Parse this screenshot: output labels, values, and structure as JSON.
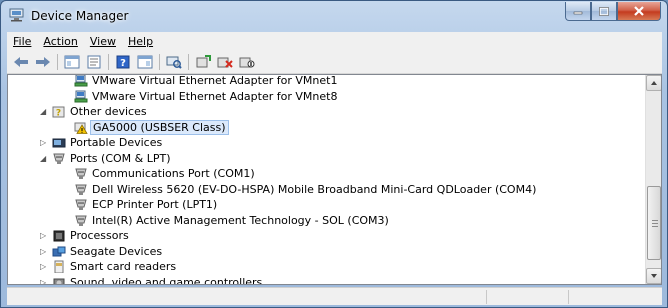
{
  "window": {
    "title": "Device Manager",
    "icon": "device-manager-icon",
    "buttons": [
      "minimize-icon",
      "maximize-icon",
      "close-icon"
    ]
  },
  "menu": {
    "file": "File",
    "action": "Action",
    "view": "View",
    "help": "Help"
  },
  "toolbar": {
    "buttons": [
      "back-arrow-icon",
      "forward-arrow-icon",
      "show-hide-console-tree-icon",
      "properties-icon",
      "help-icon",
      "view-icon",
      "scan-hardware-icon",
      "update-driver-icon",
      "uninstall-icon",
      "disable-device-icon"
    ]
  },
  "tree": {
    "items": [
      {
        "label": "VMware Virtual Ethernet Adapter for VMnet1",
        "icon": "network-adapter-icon",
        "level": 2,
        "expander": "none"
      },
      {
        "label": "VMware Virtual Ethernet Adapter for VMnet8",
        "icon": "network-adapter-icon",
        "level": 2,
        "expander": "none"
      },
      {
        "label": "Other devices",
        "icon": "unknown-device-icon",
        "level": 1,
        "expander": "expanded"
      },
      {
        "label": "GA5000 (USBSER Class)",
        "icon": "warning-device-icon",
        "level": 2,
        "expander": "none",
        "selected": true
      },
      {
        "label": "Portable Devices",
        "icon": "portable-device-icon",
        "level": 1,
        "expander": "collapsed"
      },
      {
        "label": "Ports (COM & LPT)",
        "icon": "port-icon",
        "level": 1,
        "expander": "expanded"
      },
      {
        "label": "Communications Port (COM1)",
        "icon": "port-icon",
        "level": 2,
        "expander": "none"
      },
      {
        "label": "Dell Wireless 5620 (EV-DO-HSPA) Mobile Broadband Mini-Card QDLoader (COM4)",
        "icon": "port-icon",
        "level": 2,
        "expander": "none"
      },
      {
        "label": "ECP Printer Port (LPT1)",
        "icon": "port-icon",
        "level": 2,
        "expander": "none"
      },
      {
        "label": "Intel(R) Active Management Technology - SOL (COM3)",
        "icon": "port-icon",
        "level": 2,
        "expander": "none"
      },
      {
        "label": "Processors",
        "icon": "processor-icon",
        "level": 1,
        "expander": "collapsed"
      },
      {
        "label": "Seagate Devices",
        "icon": "seagate-device-icon",
        "level": 1,
        "expander": "collapsed"
      },
      {
        "label": "Smart card readers",
        "icon": "smart-card-reader-icon",
        "level": 1,
        "expander": "collapsed"
      },
      {
        "label": "Sound, video and game controllers",
        "icon": "sound-controller-icon",
        "level": 1,
        "expander": "collapsed"
      }
    ]
  },
  "colors": {
    "titlebar": "#a9c3e2",
    "close_button": "#c43b1f",
    "selection": "#dbe9fb"
  }
}
